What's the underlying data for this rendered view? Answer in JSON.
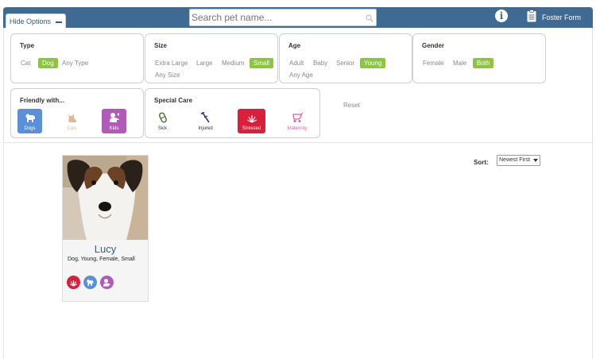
{
  "header": {
    "hide_options_label": "Hide Options",
    "search_placeholder": "Search pet name...",
    "foster_label": "Foster Form",
    "bar_color": "#3e6a94"
  },
  "filters": {
    "type": {
      "title": "Type",
      "options": [
        "Cat",
        "Dog",
        "Any Type"
      ],
      "selected": "Dog"
    },
    "size": {
      "title": "Size",
      "options": [
        "Extra Large",
        "Large",
        "Medium",
        "Small",
        "Any Size"
      ],
      "selected": "Small"
    },
    "age": {
      "title": "Age",
      "options": [
        "Adult",
        "Baby",
        "Senior",
        "Young",
        "Any Age"
      ],
      "selected": "Young"
    },
    "gender": {
      "title": "Gender",
      "options": [
        "Female",
        "Male",
        "Both"
      ],
      "selected": "Both"
    },
    "friendly": {
      "title": "Friendly with...",
      "options": [
        {
          "label": "Dogs",
          "icon": "dog-icon",
          "color": "#5b8fd8",
          "selected": true
        },
        {
          "label": "Cats",
          "icon": "cat-icon",
          "color": "#e2b98a",
          "selected": false
        },
        {
          "label": "Kids",
          "icon": "kid-icon",
          "color": "#b05bb8",
          "selected": true
        }
      ]
    },
    "special_care": {
      "title": "Special Care",
      "options": [
        {
          "label": "Sick",
          "icon": "pill-icon",
          "color": "#4a6f2a",
          "selected": false
        },
        {
          "label": "Injured",
          "icon": "crutch-icon",
          "color": "#2a3a7a",
          "selected": false
        },
        {
          "label": "Stressed",
          "icon": "stress-icon",
          "color": "#d81f3c",
          "selected": true
        },
        {
          "label": "Maternity",
          "icon": "stroller-icon",
          "color": "#e85aa8",
          "selected": false
        }
      ]
    },
    "reset_label": "Reset",
    "accent": "#8cc63f"
  },
  "sort": {
    "label": "Sort:",
    "value": "Newest First"
  },
  "pets": [
    {
      "name": "Lucy",
      "description": "Dog,  Young,  Female,  Small",
      "badges": [
        "stress-icon",
        "dog-icon",
        "kid-icon"
      ]
    }
  ]
}
